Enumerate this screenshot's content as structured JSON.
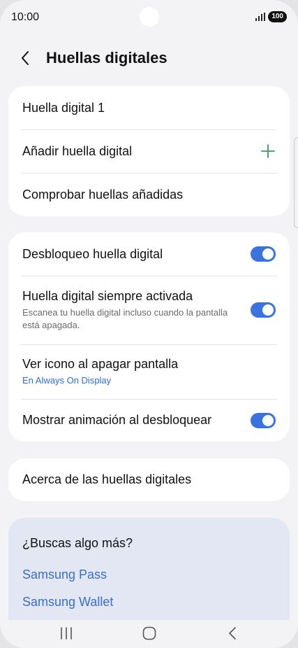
{
  "status_bar": {
    "time": "10:00",
    "battery": "100"
  },
  "header": {
    "title": "Huellas digitales"
  },
  "fingerprints_card": {
    "items": [
      {
        "label": "Huella digital 1"
      },
      {
        "label": "Añadir huella digital"
      },
      {
        "label": "Comprobar huellas añadidas"
      }
    ]
  },
  "settings_card": {
    "items": [
      {
        "label": "Desbloqueo huella digital",
        "toggle": true
      },
      {
        "label": "Huella digital siempre activada",
        "sub": "Escanea tu huella digital incluso cuando la pantalla está apagada.",
        "toggle": true
      },
      {
        "label": "Ver icono al apagar pantalla",
        "sub": "En Always On Display"
      },
      {
        "label": "Mostrar animación al desbloquear",
        "toggle": true
      }
    ]
  },
  "about_card": {
    "label": "Acerca de las huellas digitales"
  },
  "more_card": {
    "title": "¿Buscas algo más?",
    "links": [
      "Samsung Pass",
      "Samsung Wallet"
    ]
  },
  "colors": {
    "accent": "#3a73e0",
    "plus": "#2f9e5b",
    "link": "#3a6fc8"
  },
  "icons": {
    "back": "chevron-left-icon",
    "add": "plus-icon",
    "recents": "recents-icon",
    "home": "home-icon",
    "nav_back": "nav-back-icon"
  }
}
